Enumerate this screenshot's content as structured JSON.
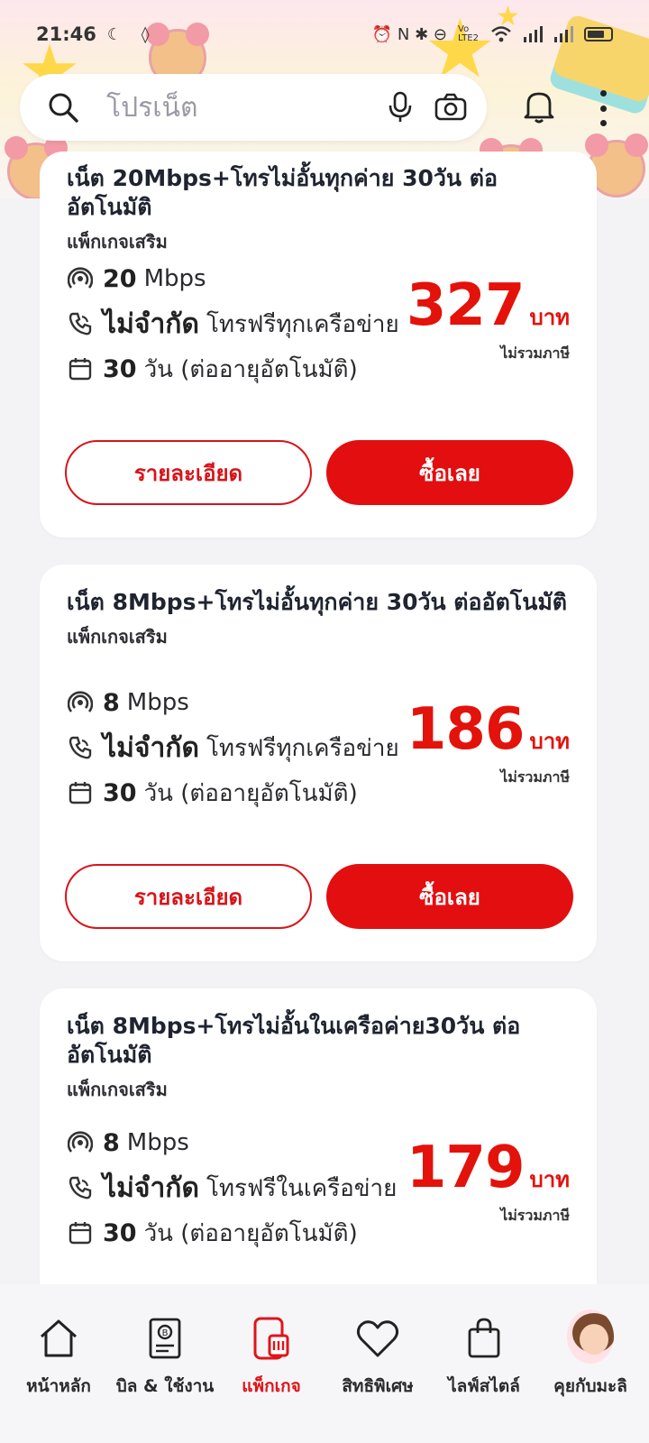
{
  "statusbar": {
    "time": "21:46",
    "left_icons": "☾ ◊",
    "right_icons": "⏰ N ✱ ⊖",
    "network": "Vo LTE2"
  },
  "search": {
    "placeholder": "โปรเน็ต"
  },
  "packages": [
    {
      "title": "เน็ต 20Mbps+โทรไม่อั้นทุกค่าย 30วัน ต่ออัตโนมัติ",
      "subtitle": "แพ็กเกจเสริม",
      "speed_value": "20",
      "speed_unit": "Mbps",
      "call_strong": "ไม่จำกัด",
      "call_text": "โทรฟรีทุกเครือข่าย",
      "days_value": "30",
      "days_text": "วัน (ต่ออายุอัตโนมัติ)",
      "price": "327",
      "currency": "บาท",
      "vat_note": "ไม่รวมภาษี",
      "detail_label": "รายละเอียด",
      "buy_label": "ซื้อเลย"
    },
    {
      "title": "เน็ต 8Mbps+โทรไม่อั้นทุกค่าย 30วัน ต่ออัตโนมัติ",
      "subtitle": "แพ็กเกจเสริม",
      "speed_value": "8",
      "speed_unit": "Mbps",
      "call_strong": "ไม่จำกัด",
      "call_text": "โทรฟรีทุกเครือข่าย",
      "days_value": "30",
      "days_text": "วัน (ต่ออายุอัตโนมัติ)",
      "price": "186",
      "currency": "บาท",
      "vat_note": "ไม่รวมภาษี",
      "detail_label": "รายละเอียด",
      "buy_label": "ซื้อเลย"
    },
    {
      "title_line1": "เน็ต 8Mbps+โทรไม่อั้นในเครือค่าย30วัน ต่อ",
      "title_line2": "อัตโนมัติ",
      "subtitle": "แพ็กเกจเสริม",
      "speed_value": "8",
      "speed_unit": "Mbps",
      "call_strong": "ไม่จำกัด",
      "call_text": "โทรฟรีในเครือข่าย",
      "days_value": "30",
      "days_text": "วัน (ต่ออายุอัตโนมัติ)",
      "price": "179",
      "currency": "บาท",
      "vat_note": "ไม่รวมภาษี"
    }
  ],
  "nav": [
    {
      "label": "หน้าหลัก",
      "icon": "home-icon"
    },
    {
      "label": "บิล & ใช้งาน",
      "icon": "bill-icon"
    },
    {
      "label": "แพ็กเกจ",
      "icon": "package-icon",
      "active": true
    },
    {
      "label": "สิทธิพิเศษ",
      "icon": "heart-icon"
    },
    {
      "label": "ไลฟ์สไตล์",
      "icon": "shopping-bag-icon"
    },
    {
      "label": "คุยกับมะลิ",
      "icon": "avatar-icon"
    }
  ],
  "colors": {
    "brand_red": "#e3120b",
    "card_bg": "#ffffff",
    "page_bg": "#f3f3f6"
  }
}
